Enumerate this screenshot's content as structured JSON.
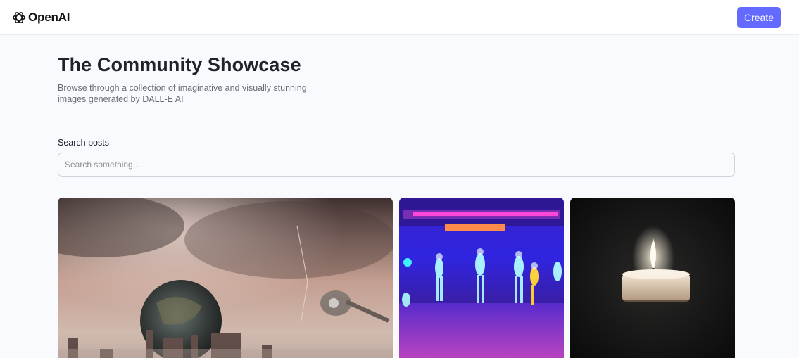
{
  "header": {
    "logo_text": "OpenAI",
    "logo_icon": "openai-logo-icon",
    "create_label": "Create",
    "accent_color": "#6469ff"
  },
  "hero": {
    "title": "The Community Showcase",
    "subtitle": "Browse through a collection of imaginative and visually stunning images generated by DALL-E AI"
  },
  "search": {
    "label": "Search posts",
    "placeholder": "Search something...",
    "value": ""
  },
  "gallery": {
    "cards": [
      {
        "image": "apocalyptic-city-planet-image"
      },
      {
        "image": "neon-dancers-image"
      },
      {
        "image": "candle-image"
      }
    ]
  }
}
